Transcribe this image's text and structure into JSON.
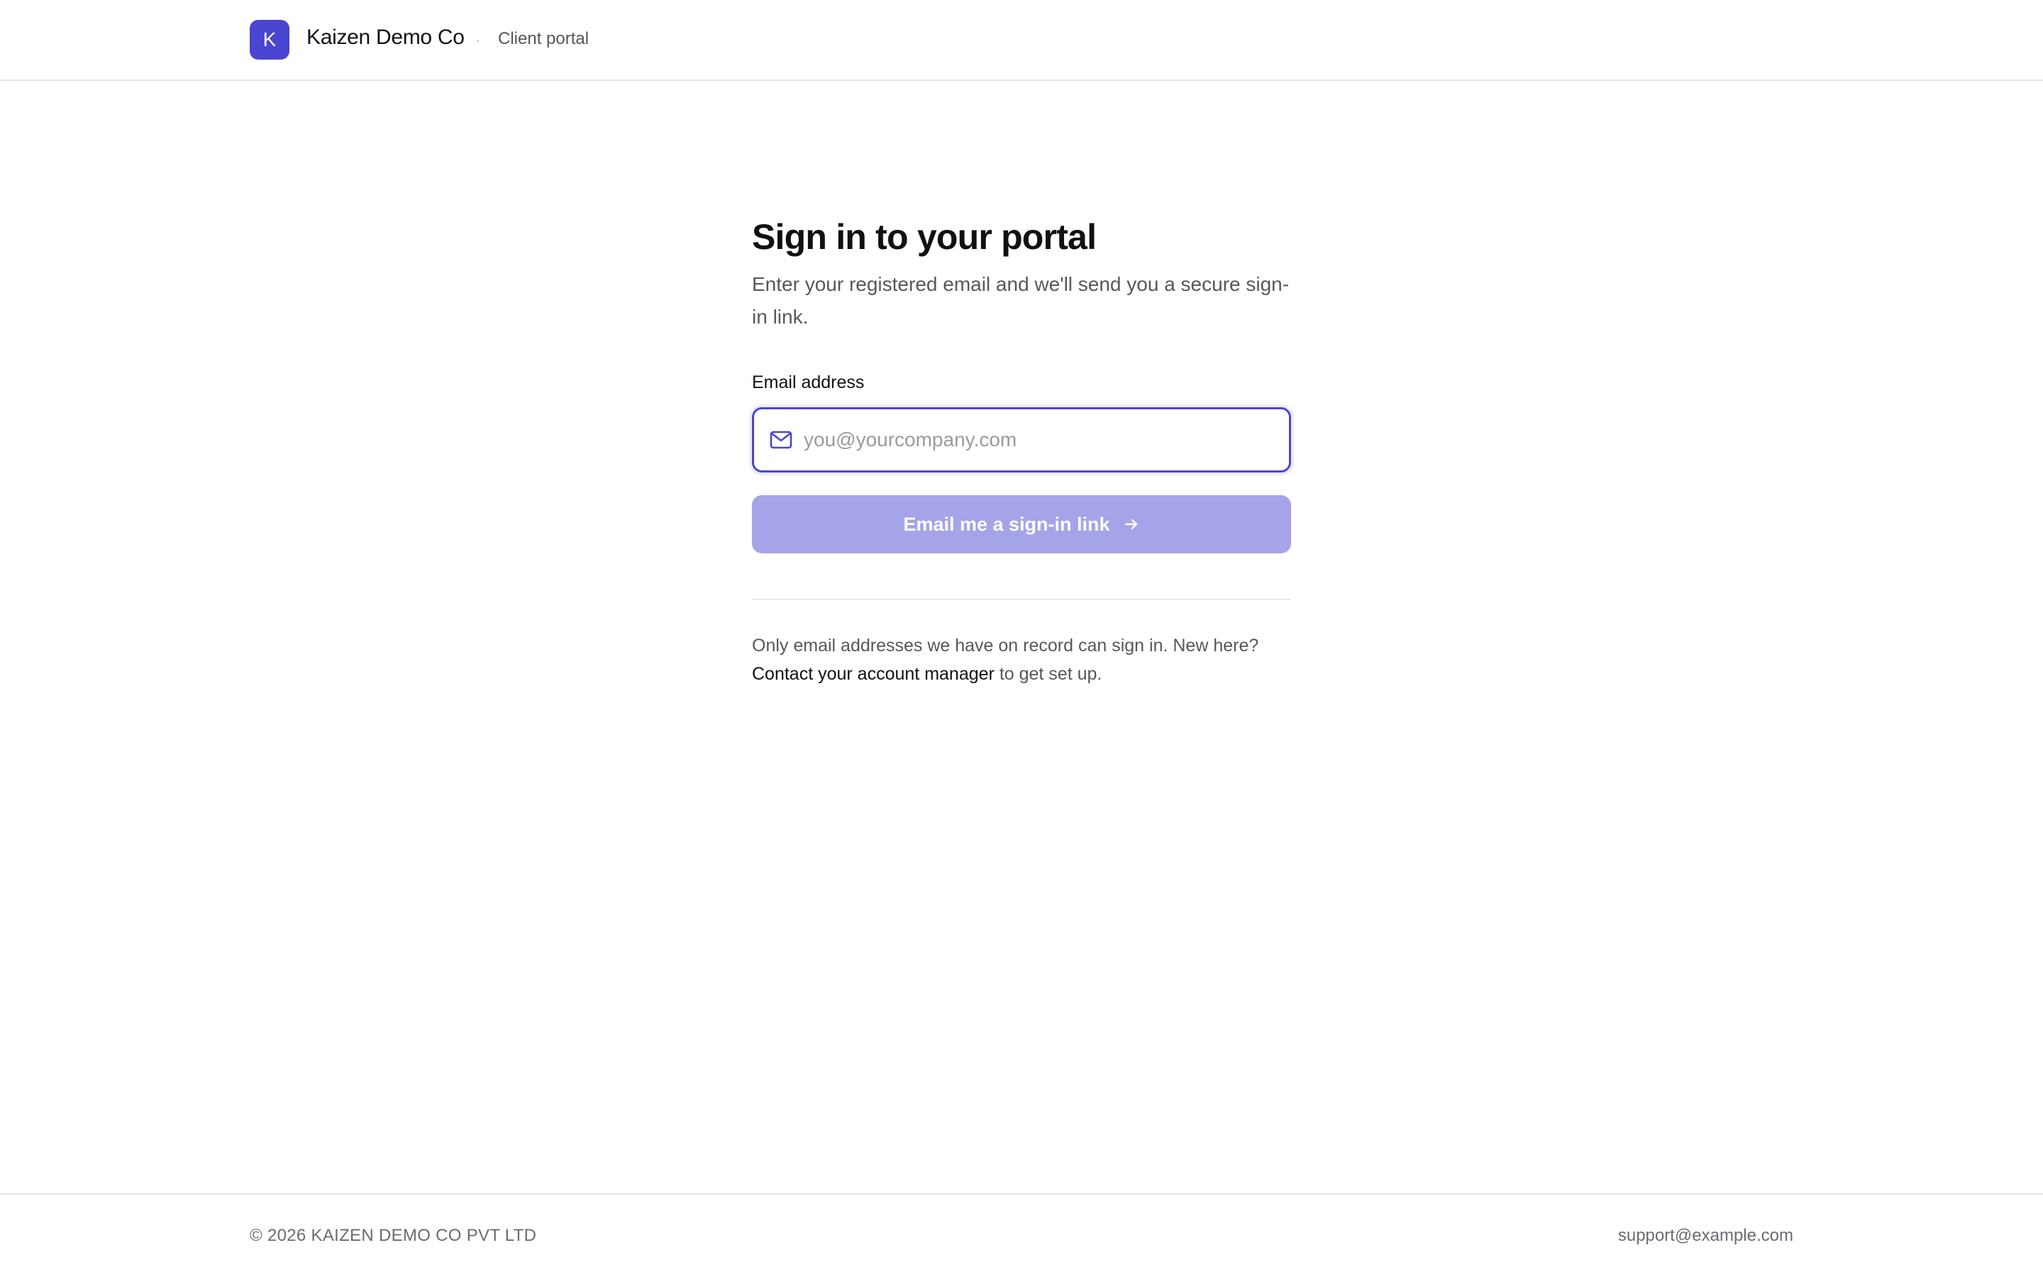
{
  "header": {
    "logo_letter": "K",
    "brand_name": "Kaizen Demo Co",
    "separator": "·",
    "subtitle": "Client portal"
  },
  "form": {
    "title": "Sign in to your portal",
    "description": "Enter your registered email and we'll send you a secure sign-in link.",
    "email_label": "Email address",
    "email_value": "",
    "email_placeholder": "you@yourcompany.com",
    "email_icon": "mail-icon",
    "submit_label": "Email me a sign-in link",
    "submit_icon": "arrow-right-icon"
  },
  "note": {
    "text_before": "Only email addresses we have on record can sign in. New here?",
    "link_text": "Contact your account manager",
    "text_after": "to get set up."
  },
  "footer": {
    "copyright": "© 2026 KAIZEN DEMO CO PVT LTD",
    "support_email": "support@example.com"
  },
  "colors": {
    "accent": "#4a45d1",
    "button_disabled": "#a5a4e8",
    "border": "#e6e6ea",
    "muted_text": "#57575c"
  }
}
